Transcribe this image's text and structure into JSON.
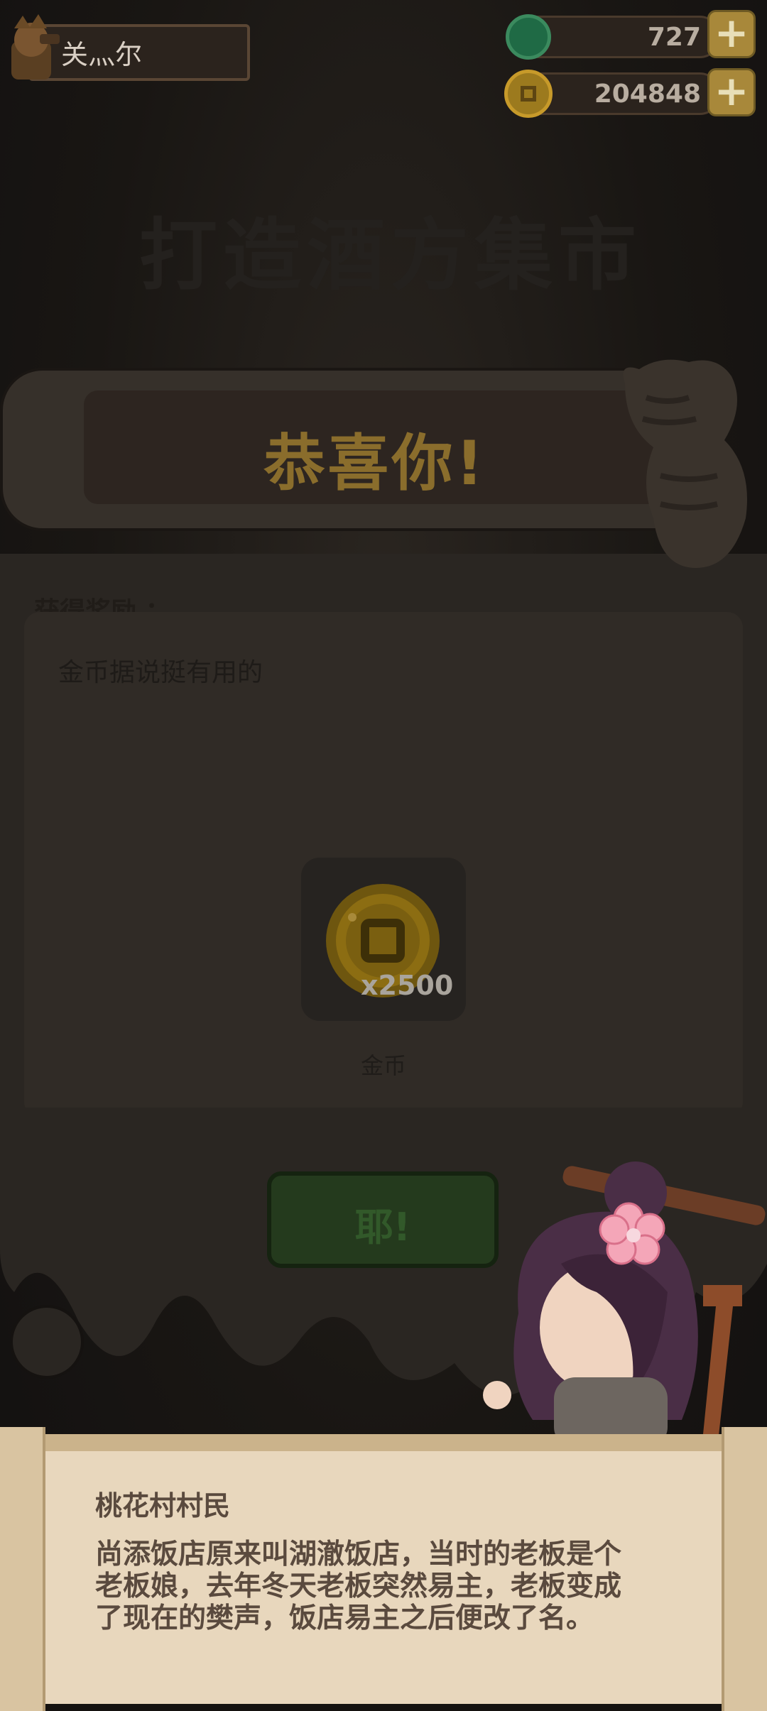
{
  "player": {
    "name": "关灬尔"
  },
  "currency": {
    "jade": {
      "icon": "jade-icon",
      "value": "727"
    },
    "coins": {
      "icon": "coin-icon",
      "value": "204848"
    },
    "plus_label": "+"
  },
  "background_title": "打造酒方集市",
  "banner": {
    "title": "恭喜你!"
  },
  "reward": {
    "heading": "获得奖励 ：",
    "description": "金币据说挺有用的",
    "item": {
      "icon": "gold-coin-icon",
      "quantity": "x2500",
      "name": "金币"
    }
  },
  "confirm_button": {
    "label": "耶!"
  },
  "dialog": {
    "speaker": "桃花村村民",
    "lines": [
      "尚添饭店原来叫湖澈饭店，当时的老板是个",
      "老板娘，去年冬天老板突然易主，老板变成",
      "了现在的樊声，饭店易主之后便改了名。"
    ]
  },
  "colors": {
    "overlay": "#151210",
    "banner_text": "#8a6d2c",
    "button": "#243a1d",
    "scroll": "#e8d7bd",
    "dialog_text": "#5a4a3e"
  }
}
